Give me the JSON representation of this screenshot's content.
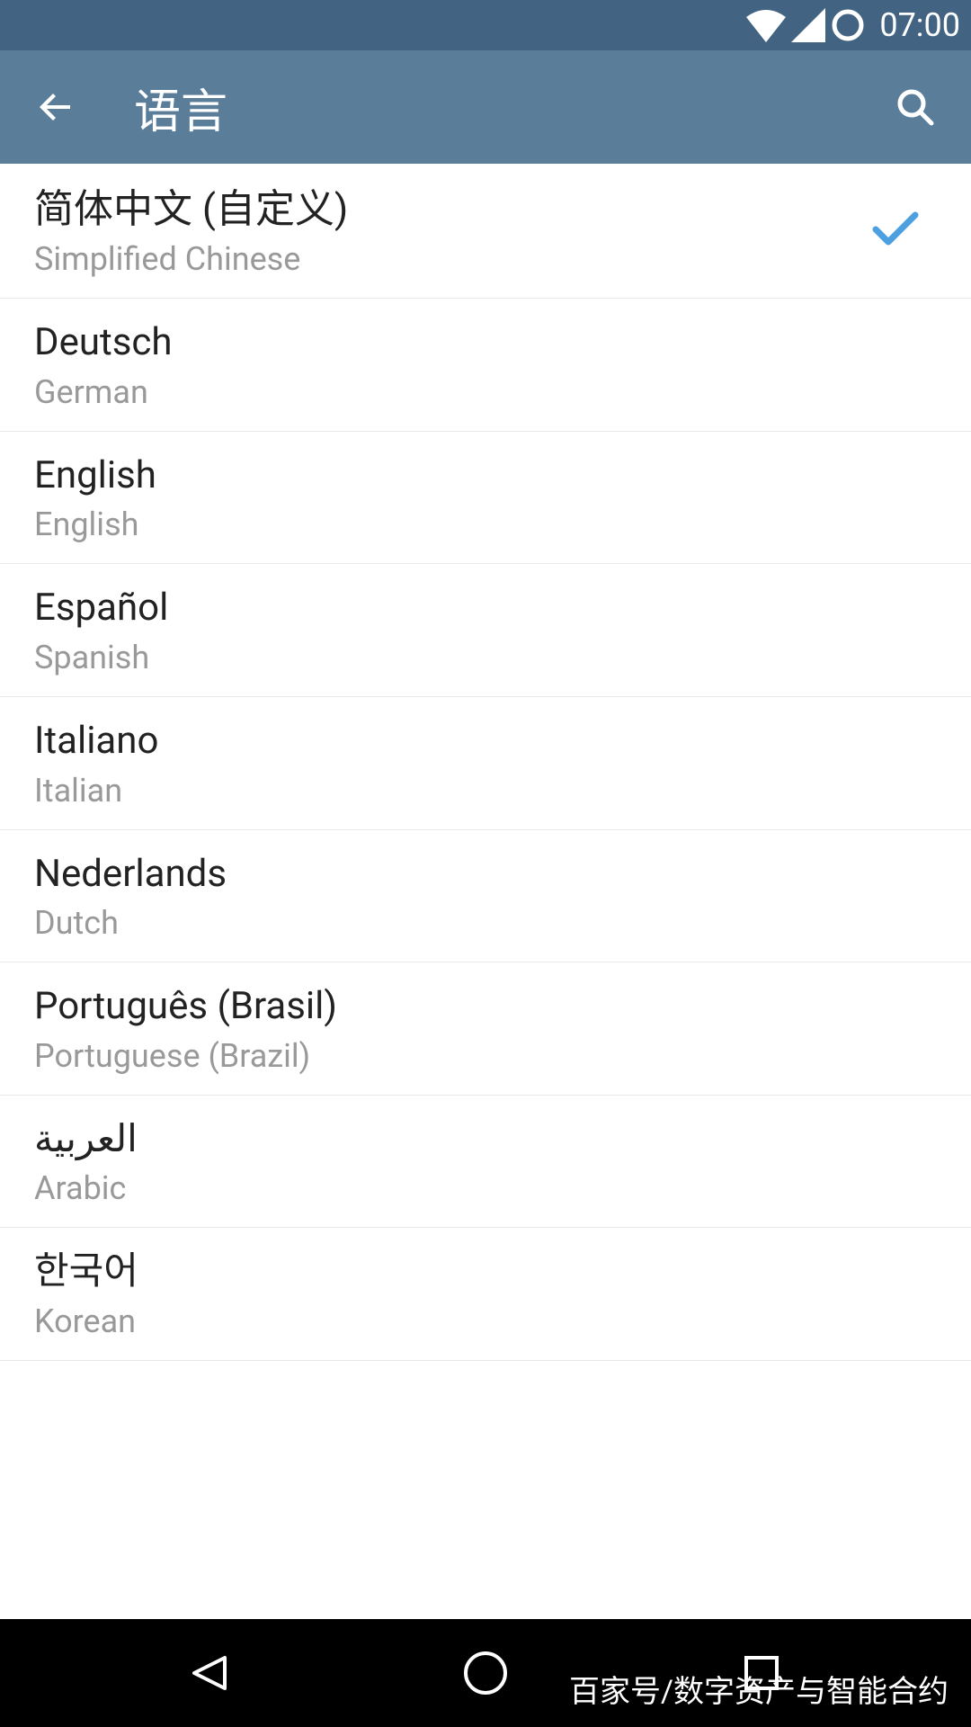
{
  "statusBar": {
    "time": "07:00"
  },
  "appBar": {
    "title": "语言"
  },
  "languages": [
    {
      "name": "简体中文 (自定义)",
      "subtitle": "Simplified Chinese",
      "selected": true
    },
    {
      "name": "Deutsch",
      "subtitle": "German",
      "selected": false
    },
    {
      "name": "English",
      "subtitle": "English",
      "selected": false
    },
    {
      "name": "Español",
      "subtitle": "Spanish",
      "selected": false
    },
    {
      "name": "Italiano",
      "subtitle": "Italian",
      "selected": false
    },
    {
      "name": "Nederlands",
      "subtitle": "Dutch",
      "selected": false
    },
    {
      "name": "Português (Brasil)",
      "subtitle": "Portuguese (Brazil)",
      "selected": false
    },
    {
      "name": "العربية",
      "subtitle": "Arabic",
      "selected": false
    },
    {
      "name": "한국어",
      "subtitle": "Korean",
      "selected": false
    }
  ],
  "watermark": "百家号/数字资产与智能合约"
}
